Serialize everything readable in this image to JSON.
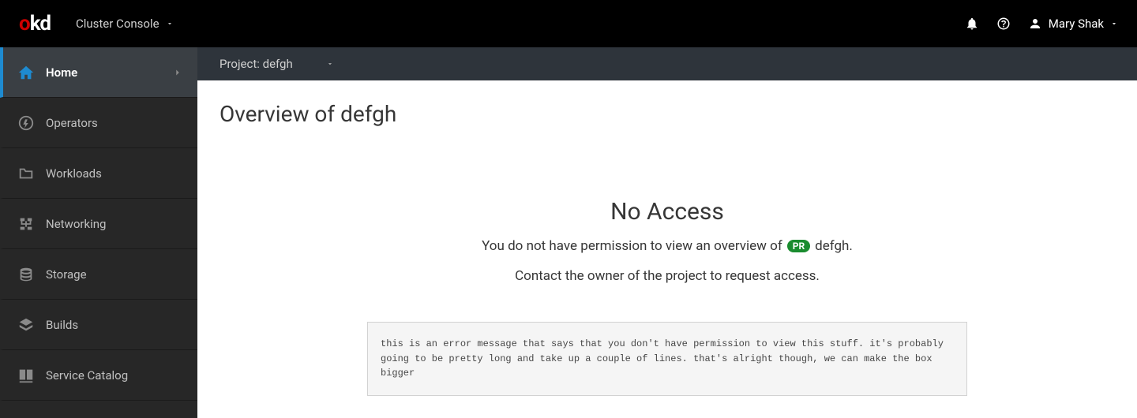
{
  "header": {
    "console_label": "Cluster Console",
    "user_name": "Mary Shak"
  },
  "sidebar": {
    "items": [
      {
        "label": "Home",
        "name": "sidebar-item-home",
        "active": true
      },
      {
        "label": "Operators",
        "name": "sidebar-item-operators"
      },
      {
        "label": "Workloads",
        "name": "sidebar-item-workloads"
      },
      {
        "label": "Networking",
        "name": "sidebar-item-networking"
      },
      {
        "label": "Storage",
        "name": "sidebar-item-storage"
      },
      {
        "label": "Builds",
        "name": "sidebar-item-builds"
      },
      {
        "label": "Service Catalog",
        "name": "sidebar-item-service-catalog"
      }
    ]
  },
  "project_bar": {
    "label": "Project: defgh"
  },
  "page": {
    "title": "Overview of defgh"
  },
  "empty_state": {
    "title": "No Access",
    "line1_prefix": "You do not have permission to view an overview of",
    "badge": "PR",
    "project_name": "defgh",
    "line1_suffix": ".",
    "line2": "Contact the owner of the project to request access.",
    "error_message": "this is an error message that says that you don't have permission to view this stuff. it's probably going to be pretty long and take up a couple of lines. that's alright though, we can make the box bigger"
  }
}
